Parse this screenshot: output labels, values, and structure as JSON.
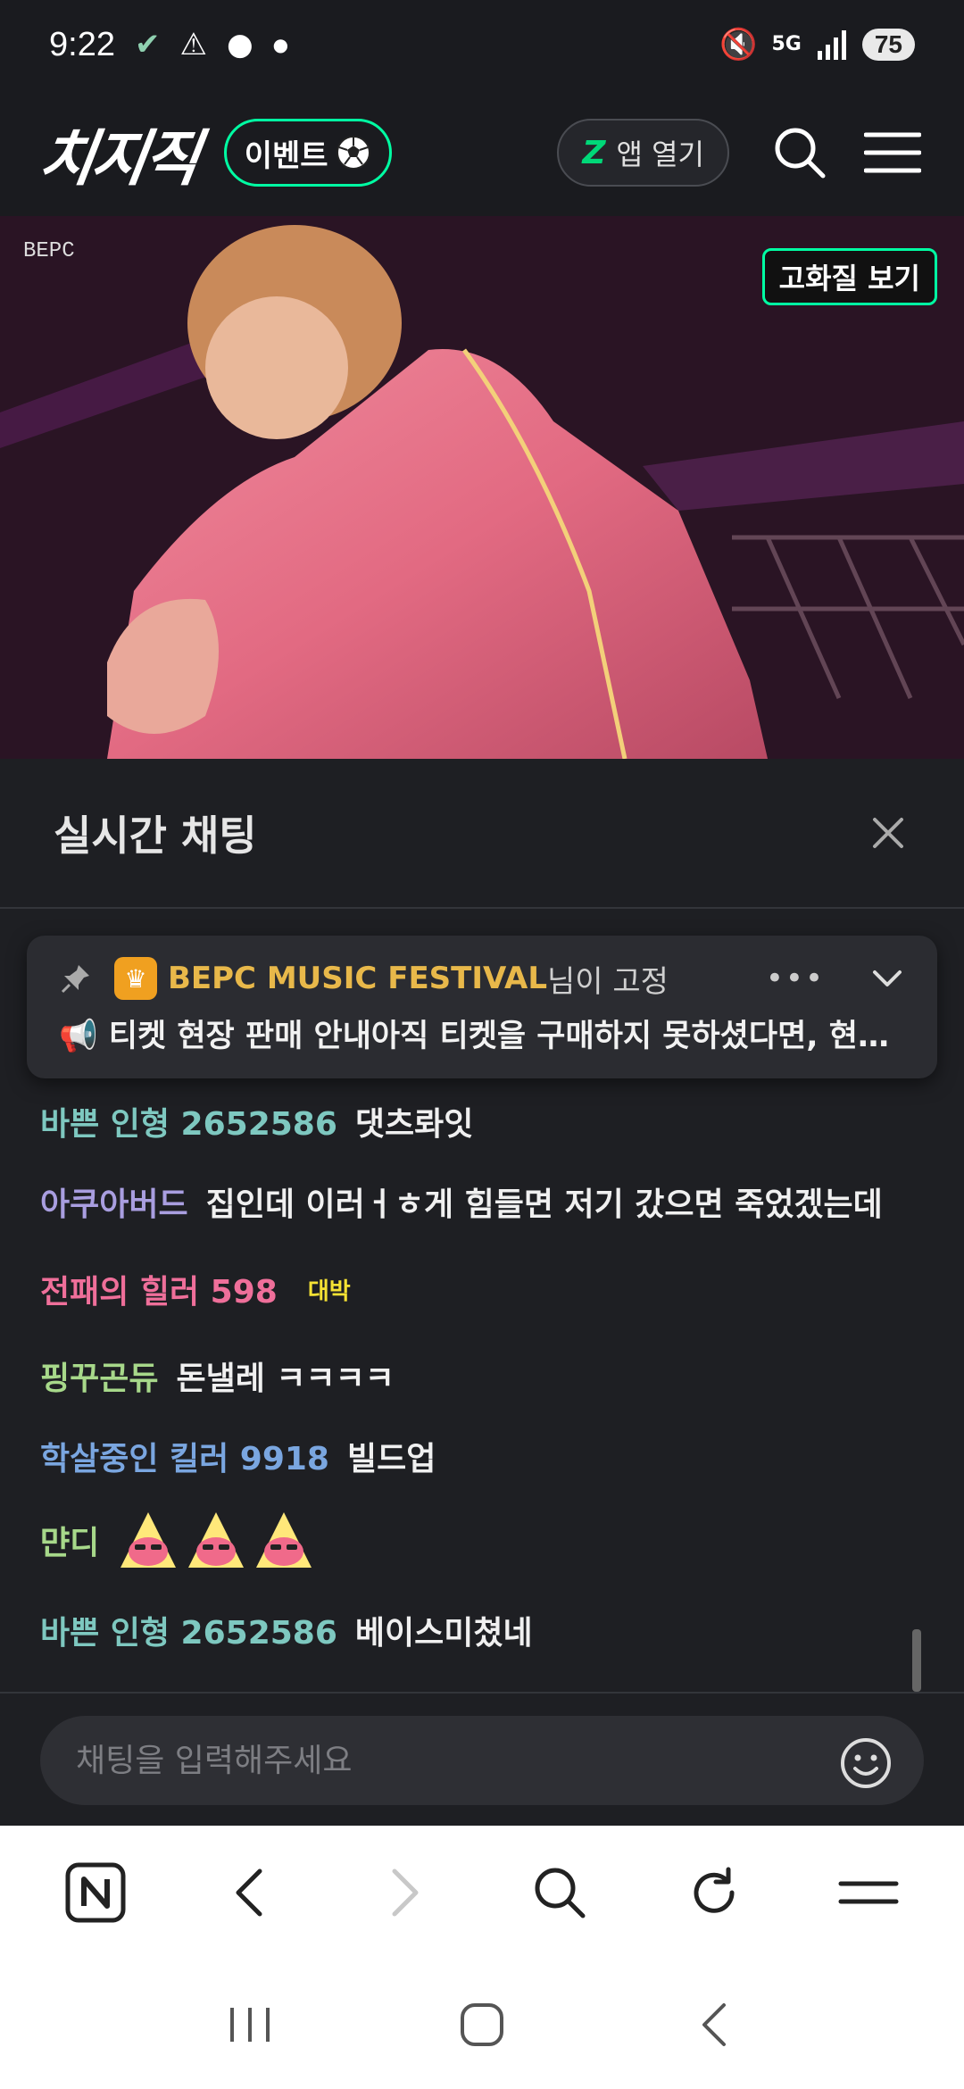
{
  "status_bar": {
    "time": "9:22",
    "network": "5G",
    "battery": "75"
  },
  "header": {
    "logo": "치지직",
    "event_label": "이벤트",
    "event_icon": "soccer-ball-icon",
    "app_open_label": "앱 열기",
    "accent": "#00ffa3"
  },
  "video": {
    "watermark": "BEPC",
    "hq_label": "고화질 보기"
  },
  "chat": {
    "title": "실시간 채팅",
    "pinned": {
      "channel_name": "BEPC MUSIC FESTIVAL",
      "suffix": "님이 고정",
      "message": "📢 티켓 현장 판매 안내아직 티켓을 구매하지 못하셨다면, 현장 구매도 가능합니다",
      "more": "•••"
    },
    "messages": [
      {
        "nick": "바쁜 인형 2652586",
        "text": "댓츠롸잇",
        "color": "#7ec8c0"
      },
      {
        "nick": "아쿠아버드",
        "text": "집인데 이러ㅓㅎ게 힘들면 저기 갔으면 죽었겠는데",
        "color": "#a99ee0"
      },
      {
        "nick": "전패의 힐러 598",
        "text": "대박",
        "color": "#ef6f9a"
      },
      {
        "nick": "핑꾸곤듀",
        "text": "돈낼레 ㅋㅋㅋㅋ",
        "color": "#a7d88a"
      },
      {
        "nick": "학살중인 킬러 9918",
        "text": "빌드업",
        "color": "#7aa6e0"
      },
      {
        "nick": "먄디",
        "text": "",
        "color": "#a7d88a"
      },
      {
        "nick": "바쁜 인형 2652586",
        "text": "베이스미쳤네",
        "color": "#7ec8c0"
      }
    ],
    "input_placeholder": "채팅을 입력해주세요"
  },
  "browser_toolbar": {
    "items": [
      "naver-home-icon",
      "back-icon",
      "forward-icon",
      "search-icon",
      "refresh-icon",
      "menu-icon"
    ]
  },
  "nav_bar": {
    "items": [
      "recent-apps-icon",
      "home-icon",
      "back-icon"
    ]
  }
}
